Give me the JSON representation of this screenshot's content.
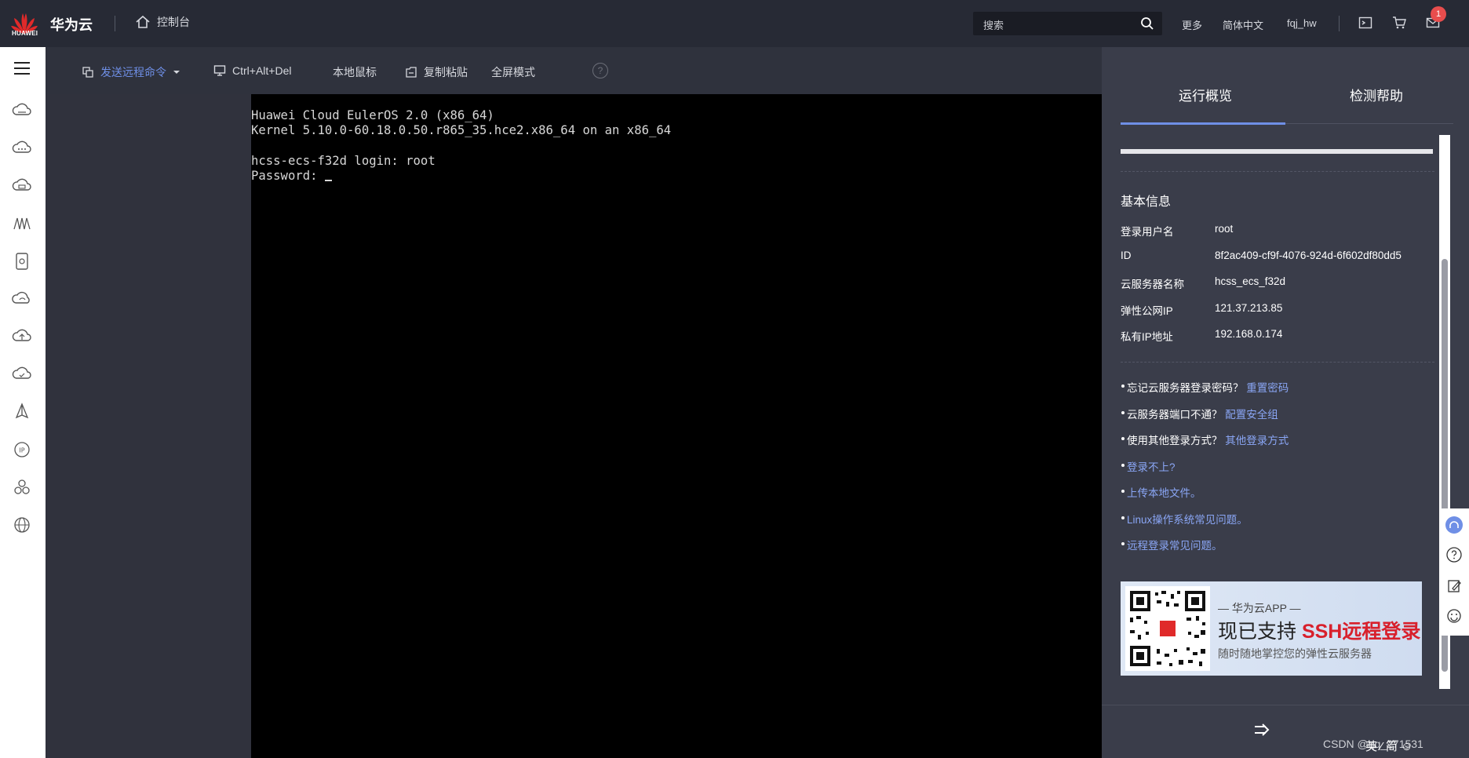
{
  "topbar": {
    "logo_text": "HUAWEI",
    "brand": "华为云",
    "console_label": "控制台",
    "search_placeholder": "搜索",
    "more": "更多",
    "language": "简体中文",
    "username": "fqj_hw",
    "message_count": "1"
  },
  "toolbar": {
    "send_command": "发送远程命令",
    "ctrl_alt_del": "Ctrl+Alt+Del",
    "local_mouse": "本地鼠标",
    "copy_paste": "复制粘贴",
    "fullscreen": "全屏模式",
    "help": "?"
  },
  "terminal": {
    "lines": "Huawei Cloud EulerOS 2.0 (x86_64)\nKernel 5.10.0-60.18.0.50.r865_35.hce2.x86_64 on an x86_64\n\nhcss-ecs-f32d login: root\nPassword: "
  },
  "panel": {
    "tabs": [
      "运行概览",
      "检测帮助"
    ],
    "section_title": "基本信息",
    "info": [
      {
        "label": "登录用户名",
        "value": "root"
      },
      {
        "label": "ID",
        "value": "8f2ac409-cf9f-4076-924d-6f602df80dd5"
      },
      {
        "label": "云服务器名称",
        "value": "hcss_ecs_f32d"
      },
      {
        "label": "弹性公网IP",
        "value": "121.37.213.85"
      },
      {
        "label": "私有IP地址",
        "value": "192.168.0.174"
      }
    ],
    "help_items": [
      {
        "text": "忘记云服务器登录密码？",
        "link": "重置密码"
      },
      {
        "text": "云服务器端口不通？",
        "link": "配置安全组"
      },
      {
        "text": "使用其他登录方式？",
        "link": "其他登录方式"
      },
      {
        "text": "",
        "link": "登录不上?"
      },
      {
        "text": "",
        "link": "上传本地文件。"
      },
      {
        "text": "",
        "link": "Linux操作系统常见问题。"
      },
      {
        "text": "",
        "link": "远程登录常见问题。"
      }
    ],
    "promo": {
      "sub": "— 华为云APP —",
      "main_prefix": "现已支持 ",
      "main_highlight": "SSH远程登录",
      "foot": "随时随地掌控您的弹性云服务器"
    }
  },
  "overlay": {
    "csdn": "CSDN @qq_271531",
    "ime": "英 ⁄ 简 ☺"
  },
  "colors": {
    "accent": "#6f8fe6",
    "topbar": "#272a35",
    "panel": "#3a3d4a",
    "promo_red": "#d8202c"
  }
}
